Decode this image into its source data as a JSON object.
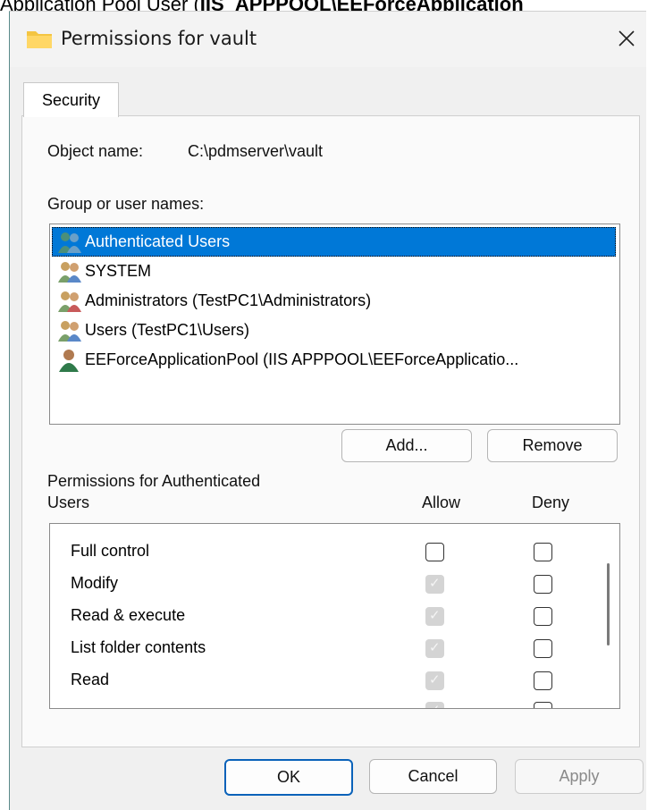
{
  "header_text": {
    "prefix": "Application Pool User (",
    "bold": "IIS_APPPOOL\\EEForceApplication"
  },
  "window": {
    "title": "Permissions for vault",
    "close_glyph": "✕"
  },
  "tabs": [
    {
      "label": "Security"
    }
  ],
  "object": {
    "label": "Object name:",
    "value": "C:\\pdmserver\\vault"
  },
  "groups": {
    "label": "Group or user names:",
    "items": [
      {
        "name": "Authenticated Users",
        "icon": "users-group-icon",
        "selected": true
      },
      {
        "name": "SYSTEM",
        "icon": "users-group-icon",
        "selected": false
      },
      {
        "name": "Administrators (TestPC1\\Administrators)",
        "icon": "users-group-icon",
        "selected": false
      },
      {
        "name": "Users (TestPC1\\Users)",
        "icon": "users-group-icon",
        "selected": false
      },
      {
        "name": "EEForceApplicationPool (IIS APPPOOL\\EEForceApplicatio...",
        "icon": "user-icon",
        "selected": false
      }
    ]
  },
  "buttons": {
    "add": "Add...",
    "remove": "Remove",
    "ok": "OK",
    "cancel": "Cancel",
    "apply": "Apply"
  },
  "permissions": {
    "title_line1": "Permissions for Authenticated",
    "title_line2": "Users",
    "allow_header": "Allow",
    "deny_header": "Deny",
    "rows": [
      {
        "name": "Full control",
        "allow": "unchecked",
        "deny": "unchecked"
      },
      {
        "name": "Modify",
        "allow": "checked-disabled",
        "deny": "unchecked"
      },
      {
        "name": "Read & execute",
        "allow": "checked-disabled",
        "deny": "unchecked"
      },
      {
        "name": "List folder contents",
        "allow": "checked-disabled",
        "deny": "unchecked"
      },
      {
        "name": "Read",
        "allow": "checked-disabled",
        "deny": "unchecked"
      },
      {
        "name": "",
        "allow": "checked-disabled",
        "deny": "unchecked"
      }
    ]
  },
  "colors": {
    "selection": "#0078d7",
    "primary_border": "#0a62b9",
    "folder": "#f4c542"
  }
}
